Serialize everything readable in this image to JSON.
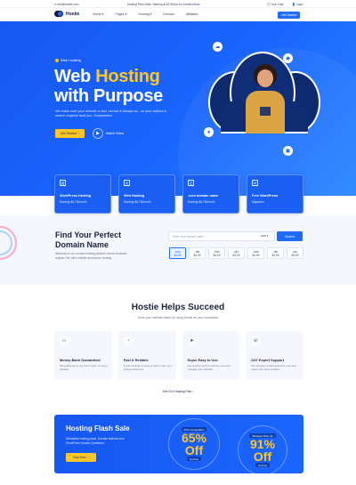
{
  "topbar": {
    "email": "info@hostie.com",
    "promo": "Hosting Flash Sale: Starting at $2.59/mo for a limited time",
    "live_chat": "Live Chat",
    "login": "Login"
  },
  "nav": {
    "brand": "Hostie",
    "items": [
      "Home ▾",
      "Pages ▾",
      "Hosting ▾",
      "Domain",
      "Affiliates"
    ],
    "cta": "Get Started"
  },
  "hero": {
    "eyebrow": "Web Hosting",
    "title_line1_a": "Web ",
    "title_line1_b": "Hosting",
    "title_line2": "with Purpose",
    "description": "We make sure your website is fast, secure & always up - so your visitors & search engines trust you. Guaranteed.",
    "primary_button": "Get Started",
    "video_button": "Watch Video"
  },
  "service_cards": [
    {
      "icon": "server-icon",
      "title": "WordPress Hosting",
      "sub": "Starting $6.79/month"
    },
    {
      "icon": "globe-icon",
      "title": "Web Hosting",
      "sub": "Starting $6.79/month"
    },
    {
      "icon": "domain-icon",
      "title": ".com domain name",
      "sub": "Starting $6.79/month"
    },
    {
      "icon": "wordpress-icon",
      "title": "Free WordPress",
      "sub": "Migration"
    }
  ],
  "domain": {
    "title_line1": "Find Your Perfect",
    "title_line2": "Domain Name",
    "description": "Welcome to our domain hosting platform where business register. We offer reliable and secure hosting.",
    "placeholder": "Enter your domain name",
    "ext": ".com ▾",
    "button": "Search",
    "tlds": [
      {
        "name": ".com",
        "price": "$4.99"
      },
      {
        "name": ".net",
        "price": "$4.99"
      },
      {
        "name": ".info",
        "price": "$4.99"
      },
      {
        "name": ".pro",
        "price": "$4.99"
      },
      {
        "name": ".com",
        "price": "$4.99"
      },
      {
        "name": ".net",
        "price": "$4.99"
      },
      {
        "name": ".pro",
        "price": "$4.99"
      }
    ]
  },
  "features": {
    "title": "Hostie Helps Succeed",
    "subtitle": "Grow your website faster by using Hostie as your foundation",
    "items": [
      {
        "icon": "wallet-icon",
        "title": "Money-Back Guaranteed",
        "desc": "We guarantee if you don't want, or every website"
      },
      {
        "icon": "speedometer-icon",
        "title": "Fast & Reliable",
        "desc": "If your website is slow or down, then you losing customers"
      },
      {
        "icon": "cursor-icon",
        "title": "Super Easy to Use",
        "desc": "Get a quick control panel to use and manage your website"
      },
      {
        "icon": "support-icon",
        "title": "24/7 Expert Support",
        "desc": "Our experts contact panel for use and solve your their problem"
      }
    ],
    "plans_link": "See Our Hosting Plan"
  },
  "flash": {
    "title": "Hosting Flash Sale",
    "description": "Affordable hosting plans. Domain features and WordPress Domain Questions.",
    "button": "Buy Now",
    "offer1": {
      "label": "First Competition",
      "value": "65%",
      "off": "Off",
      "sub": "Hosting"
    },
    "offer2": {
      "label": "Strategic Plus Up",
      "value": "91%",
      "off": "Off",
      "sub": "Hosting"
    }
  }
}
